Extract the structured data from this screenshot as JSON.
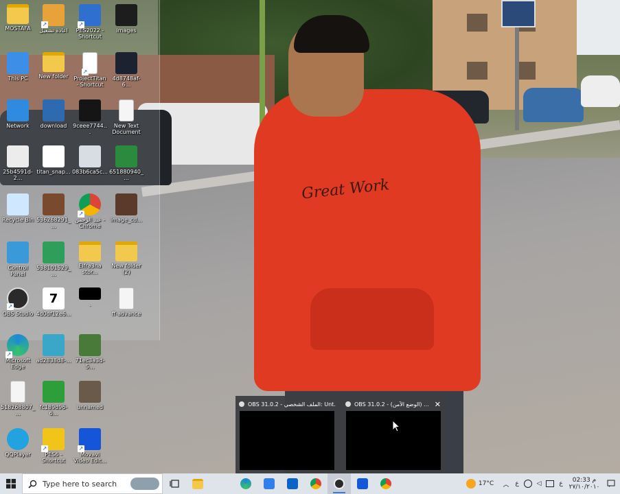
{
  "desktop": {
    "icons": [
      {
        "id": "mostafa",
        "label": "MOSTAFA",
        "icon": "folder-user-icon",
        "color": "#f2c94c",
        "shortcut": false
      },
      {
        "id": "restart",
        "label": "اعادة تشغيل",
        "icon": "restart-tool-icon",
        "color": "#e8a23a",
        "shortcut": true
      },
      {
        "id": "pes2022",
        "label": "PES2022 - Shortcut",
        "icon": "app-window-icon",
        "color": "#2f6fd0",
        "shortcut": true
      },
      {
        "id": "images",
        "label": "images",
        "icon": "wing-icon",
        "color": "#1d1d1d",
        "shortcut": false
      },
      {
        "id": "thispc",
        "label": "This PC",
        "icon": "monitor-icon",
        "color": "#3c8ee6",
        "shortcut": false
      },
      {
        "id": "newfolder",
        "label": "New folder",
        "icon": "folder-icon",
        "color": "#f2c94c",
        "shortcut": false
      },
      {
        "id": "projecttitan",
        "label": "ProjectTitan - Shortcut",
        "icon": "file-icon",
        "color": "#ffffff",
        "shortcut": true
      },
      {
        "id": "4d8748",
        "label": "4d8748af-6...",
        "icon": "image-thumb-icon",
        "color": "#1c2230",
        "shortcut": false
      },
      {
        "id": "network",
        "label": "Network",
        "icon": "network-icon",
        "color": "#2e8be0",
        "shortcut": false
      },
      {
        "id": "download",
        "label": "download",
        "icon": "image-thumb-icon",
        "color": "#2e6ab0",
        "shortcut": false
      },
      {
        "id": "9ceee",
        "label": "9ceee7744...",
        "icon": "image-thumb-icon",
        "color": "#151515",
        "shortcut": false
      },
      {
        "id": "newtext",
        "label": "New Text Document",
        "icon": "text-file-icon",
        "color": "#f5f5f5",
        "shortcut": false
      },
      {
        "id": "25b4591",
        "label": "25b4591d-2...",
        "icon": "image-thumb-icon",
        "color": "#ececec",
        "shortcut": false
      },
      {
        "id": "titansnap",
        "label": "titan_snap...",
        "icon": "image-thumb-icon",
        "color": "#ffffff",
        "shortcut": false
      },
      {
        "id": "083b6",
        "label": "083b6ca5c...",
        "icon": "image-thumb-icon",
        "color": "#d8dde4",
        "shortcut": false
      },
      {
        "id": "651880",
        "label": "651880940_...",
        "icon": "image-thumb-icon",
        "color": "#2b8a3e",
        "shortcut": false
      },
      {
        "id": "recycle",
        "label": "Recycle Bin",
        "icon": "recycle-bin-icon",
        "color": "#d0e8ff",
        "shortcut": false
      },
      {
        "id": "536268",
        "label": "536268291_...",
        "icon": "image-thumb-icon",
        "color": "#7a4a2e",
        "shortcut": false
      },
      {
        "id": "chrome",
        "label": "عبد الرحمن - Chrome",
        "icon": "chrome-icon",
        "color": "#db4437",
        "shortcut": true
      },
      {
        "id": "imagecd",
        "label": "image_cd...",
        "icon": "image-thumb-icon",
        "color": "#5a3a2a",
        "shortcut": false
      },
      {
        "id": "control",
        "label": "Control Panel",
        "icon": "control-panel-icon",
        "color": "#3a9ad9",
        "shortcut": false
      },
      {
        "id": "538101",
        "label": "538101529_...",
        "icon": "image-thumb-icon",
        "color": "#2e9e5a",
        "shortcut": false
      },
      {
        "id": "elfra3na",
        "label": "Elfra3na stor...",
        "icon": "folder-icon",
        "color": "#f2c94c",
        "shortcut": false
      },
      {
        "id": "newfolder2",
        "label": "New folder (2)",
        "icon": "folder-icon",
        "color": "#f2c94c",
        "shortcut": false
      },
      {
        "id": "obs",
        "label": "OBS Studio",
        "icon": "obs-icon",
        "color": "#2a2a2a",
        "shortcut": true
      },
      {
        "id": "4d0df",
        "label": "4d0df12e6...",
        "icon": "calendar-icon",
        "color": "#ffffff",
        "shortcut": false
      },
      {
        "id": "blank",
        "label": ".",
        "icon": "black-image-icon",
        "color": "#000000",
        "shortcut": false
      },
      {
        "id": "ffadvance",
        "label": "ff-advance",
        "icon": "text-file-icon",
        "color": "#f5f5f5",
        "shortcut": false
      },
      {
        "id": "edge",
        "label": "Microsoft Edge",
        "icon": "edge-icon",
        "color": "#1e88d6",
        "shortcut": true
      },
      {
        "id": "ad2838",
        "label": "ad2838d8-...",
        "icon": "image-thumb-icon",
        "color": "#3aa6c8",
        "shortcut": false
      },
      {
        "id": "71ec3",
        "label": "71ec3a3d-5...",
        "icon": "image-thumb-icon",
        "color": "#4a7a3a",
        "shortcut": false
      },
      {
        "id": "518268",
        "label": "518268807_...",
        "icon": "text-file-icon",
        "color": "#f5f5f5",
        "shortcut": false
      },
      {
        "id": "fc189",
        "label": "fc189d96-6...",
        "icon": "image-thumb-icon",
        "color": "#2e9e3a",
        "shortcut": false
      },
      {
        "id": "unnamed",
        "label": "unnamed",
        "icon": "image-thumb-icon",
        "color": "#6a5a4a",
        "shortcut": false
      },
      {
        "id": "qqplayer",
        "label": "QQPlayer",
        "icon": "qqplayer-icon",
        "color": "#22a3e0",
        "shortcut": false
      },
      {
        "id": "pes6",
        "label": "PES6 - Shortcut",
        "icon": "pes6-icon",
        "color": "#f0c419",
        "shortcut": true
      },
      {
        "id": "movavi",
        "label": "Movavi Video Edit...",
        "icon": "movavi-icon",
        "color": "#1455d9",
        "shortcut": true
      }
    ]
  },
  "wallpaper": {
    "shirt_text": "Great Work"
  },
  "thumbnails": [
    {
      "title": "OBS 31.0.2 - الملف الشخصي: Unt..."
    },
    {
      "title": "OBS 31.0.2 - (الوضع الآمن) ...",
      "close": "✕"
    }
  ],
  "taskbar": {
    "search_placeholder": "Type here to search",
    "weather": "17°C",
    "time": "02:33 م",
    "date": "٢٧/١٠/٢٠١٠",
    "lang": "ع",
    "accent": "#3a7bd5"
  }
}
